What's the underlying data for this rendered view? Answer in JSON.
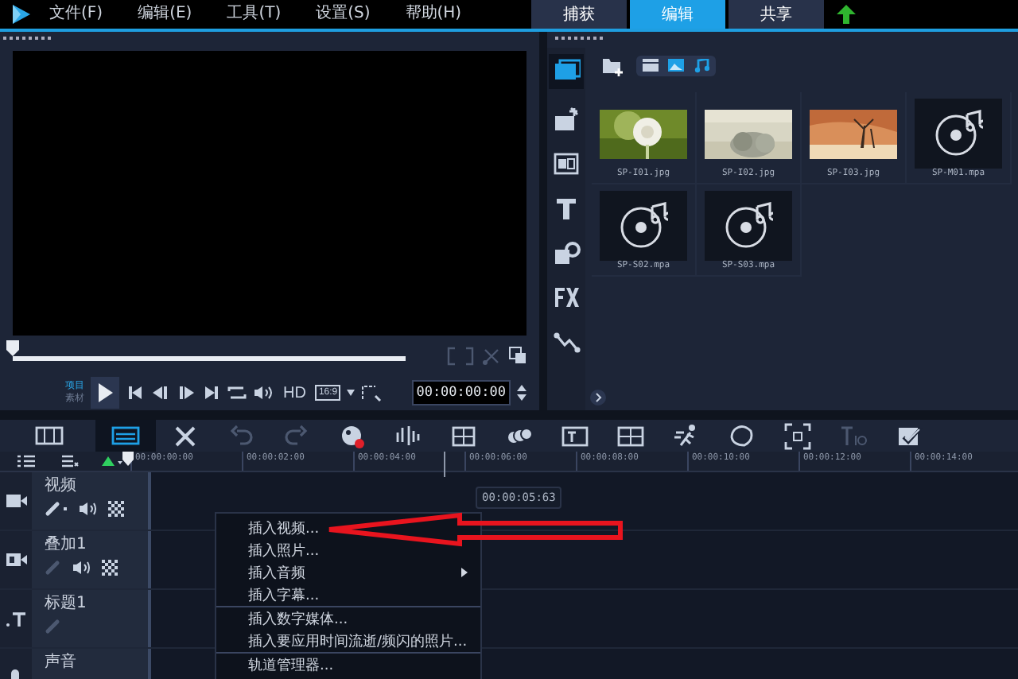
{
  "menu": [
    "文件(F)",
    "编辑(E)",
    "工具(T)",
    "设置(S)",
    "帮助(H)"
  ],
  "tabs": [
    {
      "label": "捕获",
      "selected": false
    },
    {
      "label": "编辑",
      "selected": true
    },
    {
      "label": "共享",
      "selected": false
    }
  ],
  "player": {
    "level": 0,
    "modes": [
      {
        "label": "项目",
        "selected": true
      },
      {
        "label": "素材",
        "selected": false
      }
    ],
    "hd": "HD",
    "aspect": "16:9",
    "timecode": "00:00:00:00"
  },
  "library": {
    "items": [
      {
        "name": "SP-I01.jpg",
        "kind": "picture"
      },
      {
        "name": "SP-I02.jpg",
        "kind": "picture"
      },
      {
        "name": "SP-I03.jpg",
        "kind": "picture"
      },
      {
        "name": "SP-M01.mpa",
        "kind": "audio"
      },
      {
        "name": "SP-S02.mpa",
        "kind": "audio"
      },
      {
        "name": "SP-S03.mpa",
        "kind": "audio"
      }
    ]
  },
  "timeline": {
    "view_modes": [
      {
        "kind": "storyboard",
        "selected": false
      },
      {
        "kind": "timeline",
        "selected": true
      }
    ],
    "ruler": [
      "00:00:00:00",
      "00:00:02:00",
      "00:00:04:00",
      "00:00:06:00",
      "00:00:08:00",
      "00:00:10:00",
      "00:00:12:00",
      "00:00:14:00"
    ],
    "cursor_time": "00:00:05:63",
    "tracks": [
      {
        "name": "视频",
        "kind": "video"
      },
      {
        "name": "叠加1",
        "kind": "overlay"
      },
      {
        "name": "标题1",
        "kind": "title"
      },
      {
        "name": "声音",
        "kind": "voice"
      }
    ],
    "context_menu": [
      {
        "kind": "item",
        "label": "插入视频...",
        "submenu": false
      },
      {
        "kind": "item",
        "label": "插入照片...",
        "submenu": false
      },
      {
        "kind": "item",
        "label": "插入音频",
        "submenu": true
      },
      {
        "kind": "item",
        "label": "插入字幕...",
        "submenu": false
      },
      {
        "kind": "separator"
      },
      {
        "kind": "item",
        "label": "插入数字媒体...",
        "submenu": false
      },
      {
        "kind": "item",
        "label": "插入要应用时间流逝/频闪的照片...",
        "submenu": false
      },
      {
        "kind": "separator"
      },
      {
        "kind": "item",
        "label": "轨道管理器...",
        "submenu": false
      }
    ]
  }
}
